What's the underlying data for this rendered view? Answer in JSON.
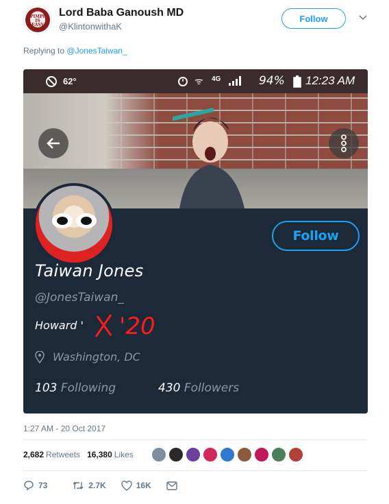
{
  "tweet": {
    "author_name": "Lord Baba Ganoush MD",
    "author_handle": "@KlintonwithaK",
    "follow_label": "Follow",
    "avatar_text": "PIMPIN IS EASY",
    "reply_prefix": "Replying to",
    "reply_to": "@JonesTaiwan_",
    "timestamp": "1:27 AM - 20 Oct 2017",
    "retweets_count": "2,682",
    "retweets_label": "Retweets",
    "likes_count": "16,380",
    "likes_label": "Likes",
    "replies_action": "73",
    "retweets_action": "2.7K",
    "likes_action": "16K"
  },
  "screenshot": {
    "status_bar": {
      "temperature": "62°",
      "network": "4G",
      "battery": "94%",
      "clock": "12:23 AM"
    },
    "profile": {
      "follow_label": "Follow",
      "name": "Taiwan Jones",
      "handle": "@JonesTaiwan_",
      "bio": "Howard '",
      "bio_scribble": "'20",
      "location": "Washington, DC",
      "following_count": "103",
      "following_label": "Following",
      "followers_count": "430",
      "followers_label": "Followers"
    }
  },
  "colors": {
    "accent": "#1da1f2",
    "scribble": "#ff1a1a",
    "profile_bg": "#1c2938"
  },
  "liker_colors": [
    "#7d8ea0",
    "#2a2a2a",
    "#6b3fa0",
    "#d4265a",
    "#2e7ad1",
    "#8a5a3c",
    "#c2185b",
    "#4a7f5a",
    "#b0403a"
  ]
}
